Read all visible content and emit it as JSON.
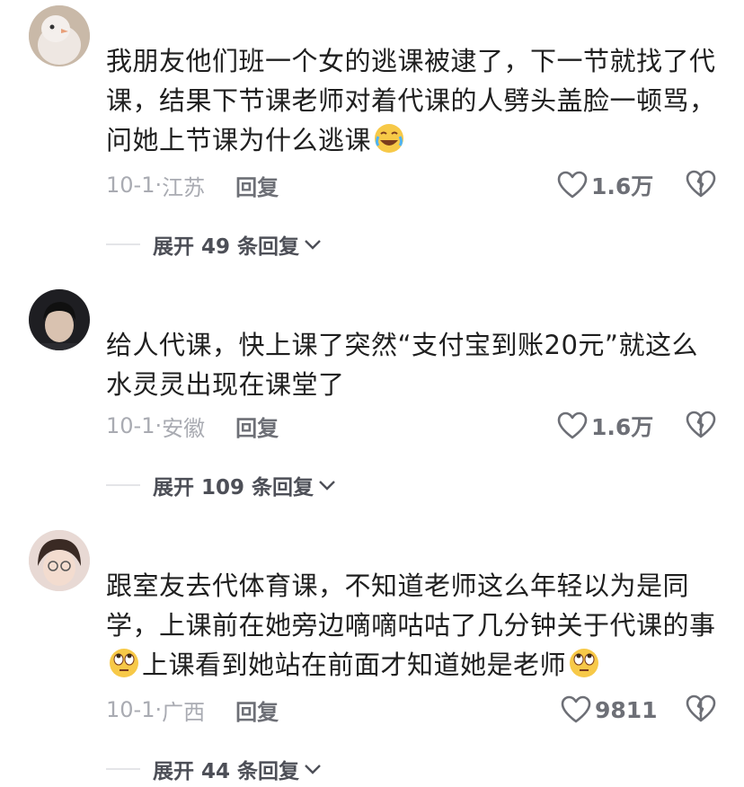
{
  "comments": [
    {
      "text_before": "我朋友他们班一个女的逃课被逮了，下一节就找了代课，结果下节课老师对着代课的人劈头盖脸一顿骂，问她上节课为什么逃课",
      "emoji_name": "laughing-tears-emoji",
      "date": "10-1·",
      "location": "江苏",
      "reply_label": "回复",
      "likes": "1.6万",
      "expand_label": "展开 49 条回复"
    },
    {
      "text": "给人代课，快上课了突然“支付宝到账20元”就这么水灵灵出现在课堂了",
      "date": "10-1·",
      "location": "安徽",
      "reply_label": "回复",
      "likes": "1.6万",
      "expand_label": "展开 109 条回复"
    },
    {
      "text_part1": "跟室友去代体育课，不知道老师这么年轻以为是同学，上课前在她旁边嘀嘀咕咕了几分钟关于代课的事",
      "text_part2": "上课看到她站在前面才知道她是老师",
      "emoji_name": "rolling-eyes-emoji",
      "date": "10-1·",
      "location": "广西",
      "reply_label": "回复",
      "likes": "9811",
      "expand_label": "展开 44 条回复"
    }
  ]
}
